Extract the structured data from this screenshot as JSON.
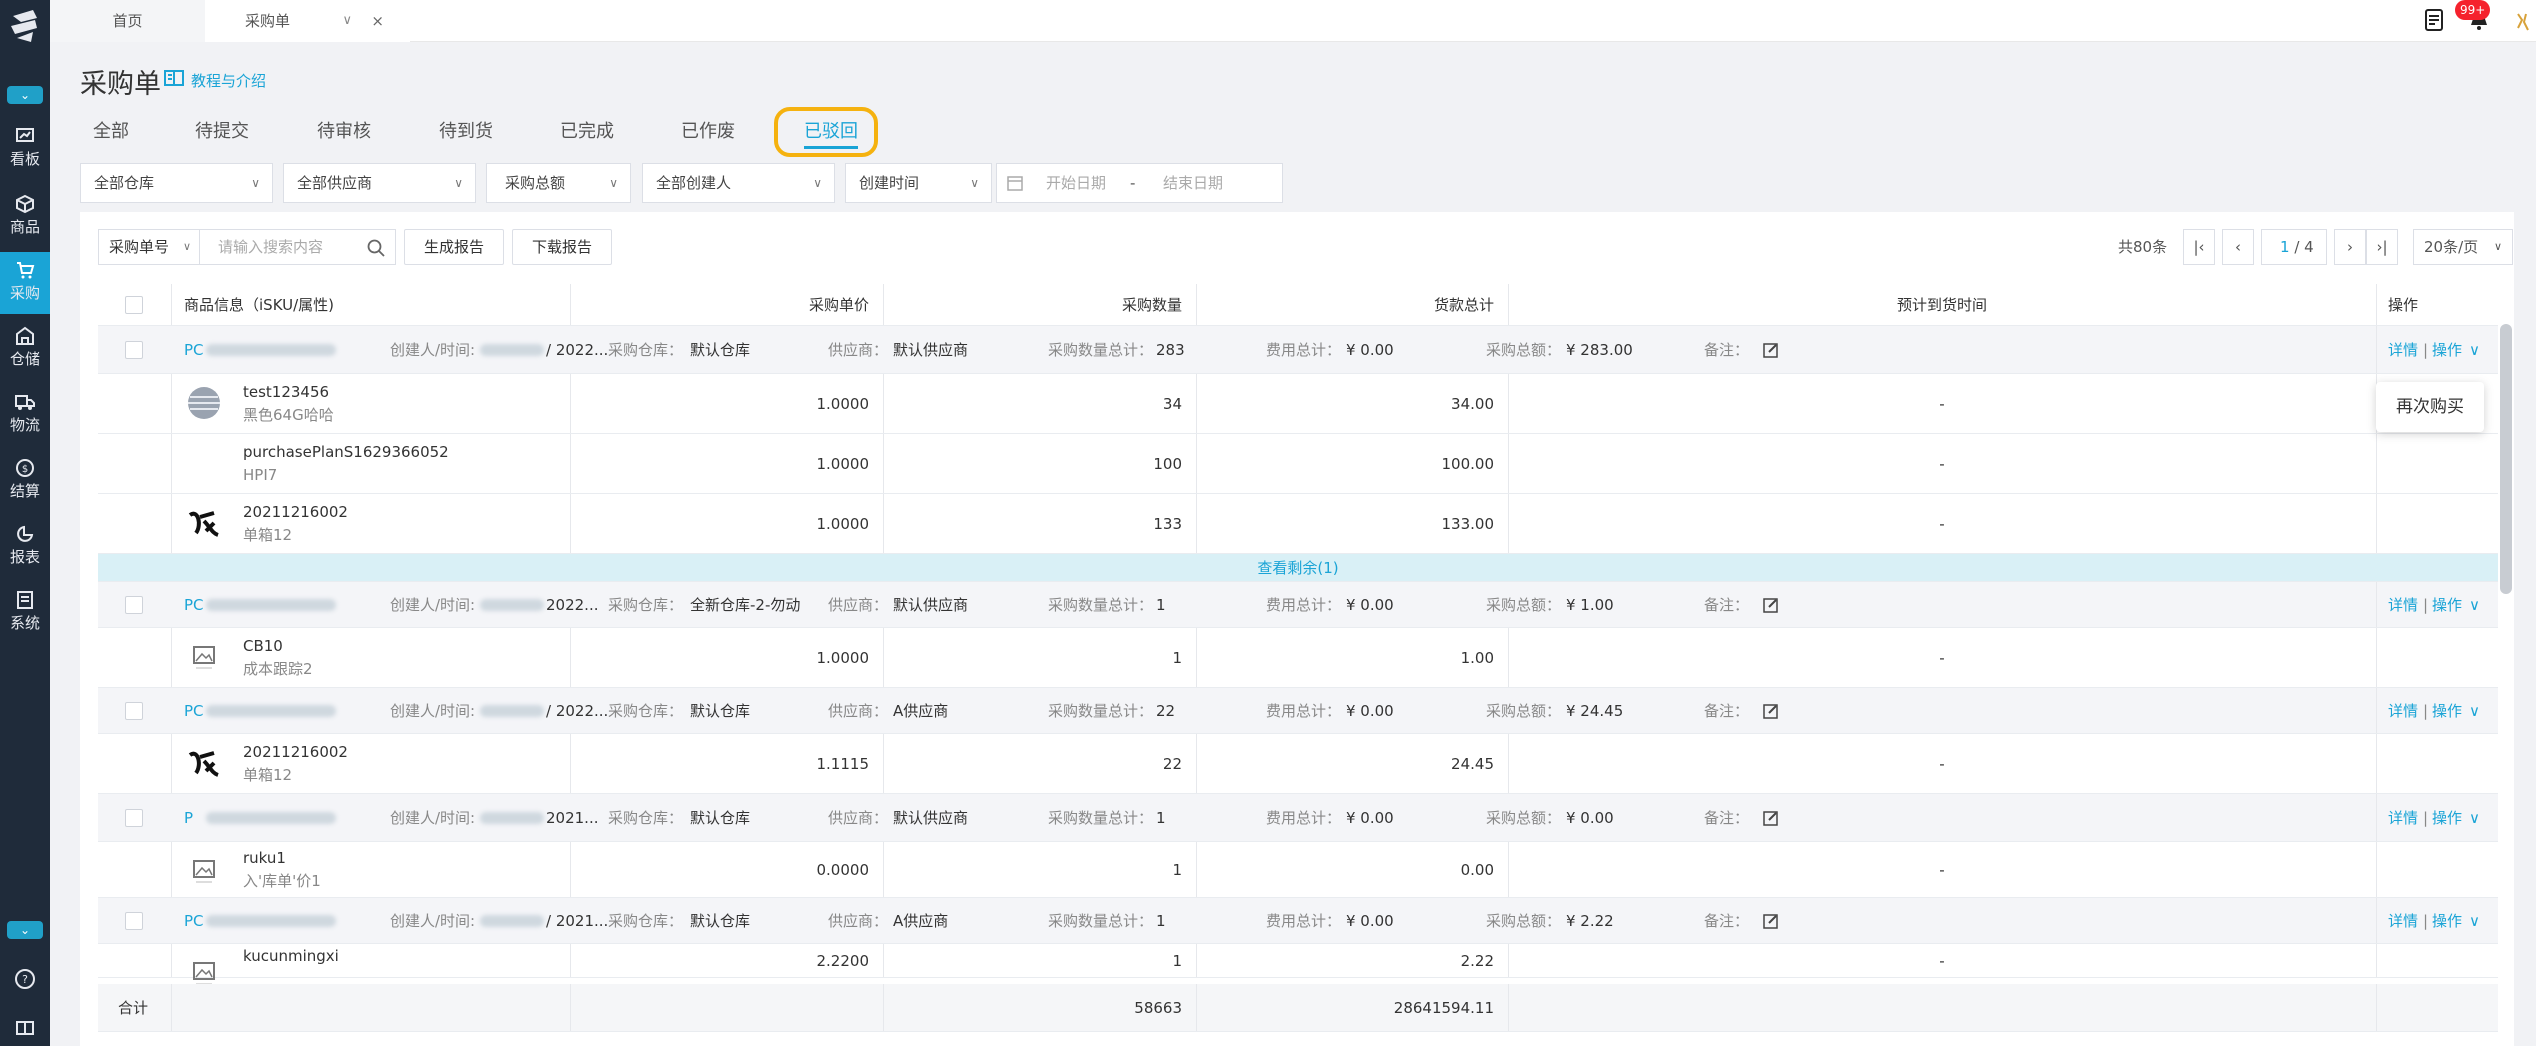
{
  "sidebar": {
    "items": [
      {
        "name": "dashboard",
        "label": "看板"
      },
      {
        "name": "goods",
        "label": "商品"
      },
      {
        "name": "purchase",
        "label": "采购"
      },
      {
        "name": "warehouse",
        "label": "仓储"
      },
      {
        "name": "logistics",
        "label": "物流"
      },
      {
        "name": "settlement",
        "label": "结算"
      },
      {
        "name": "report",
        "label": "报表"
      },
      {
        "name": "system",
        "label": "系统"
      }
    ]
  },
  "topbar": {
    "tab_home": "首页",
    "tab_purchase": "采购单",
    "close": "×",
    "badge": "99+"
  },
  "page": {
    "title": "采购单",
    "tutorial_link": "教程与介绍"
  },
  "status_tabs": [
    "全部",
    "待提交",
    "待审核",
    "待到货",
    "已完成",
    "已作废",
    "已驳回"
  ],
  "filters": {
    "warehouse": "全部仓库",
    "supplier": "全部供应商",
    "total": "采购总额",
    "creator": "全部创建人",
    "time": "创建时间",
    "start_date": "开始日期",
    "date_sep": "-",
    "end_date": "结束日期"
  },
  "search": {
    "field": "采购单号",
    "placeholder": "请输入搜索内容",
    "gen_report": "生成报告",
    "download_report": "下载报告"
  },
  "pagination": {
    "total": "共80条",
    "current": "1",
    "of": "/ 4",
    "page_size": "20条/页"
  },
  "columns": {
    "info": "商品信息（iSKU/属性)",
    "unit_price": "采购单价",
    "qty": "采购数量",
    "amount": "货款总计",
    "eta": "预计到货时间",
    "ops": "操作"
  },
  "labels": {
    "creator": "创建人/时间:",
    "warehouse": "采购仓库：",
    "supplier": "供应商：",
    "qty_total": "采购数量总计：",
    "fee_total": "费用总计：",
    "purchase_total": "采购总额：",
    "remark": "备注：",
    "detail": "详情",
    "ops": "操作",
    "sep": "|"
  },
  "orders": [
    {
      "id_prefix": "PC",
      "date": "/ 2022...",
      "warehouse": "默认仓库",
      "supplier": "默认供应商",
      "qty_total": "283",
      "fee_total": "¥ 0.00",
      "purchase_total": "¥ 283.00",
      "items": [
        {
          "name": "test123456",
          "sku": "黑色64G哈哈",
          "price": "1.0000",
          "qty": "34",
          "amount": "34.00",
          "eta": "-",
          "img": "circle"
        },
        {
          "name": "purchasePlanS1629366052",
          "sku": "HPI7",
          "price": "1.0000",
          "qty": "100",
          "amount": "100.00",
          "eta": "-",
          "img": "none"
        },
        {
          "name": "20211216002",
          "sku": "单箱12",
          "price": "1.0000",
          "qty": "133",
          "amount": "133.00",
          "eta": "-",
          "img": "calli"
        }
      ]
    },
    {
      "id_prefix": "PC",
      "date": "2022...",
      "warehouse": "全新仓库-2-勿动",
      "supplier": "默认供应商",
      "qty_total": "1",
      "fee_total": "¥ 0.00",
      "purchase_total": "¥ 1.00",
      "items": [
        {
          "name": "CB10",
          "sku": "成本跟踪2",
          "price": "1.0000",
          "qty": "1",
          "amount": "1.00",
          "eta": "-",
          "img": "placeholder"
        }
      ]
    },
    {
      "id_prefix": "PC",
      "date": "/ 2022...",
      "warehouse": "默认仓库",
      "supplier": "A供应商",
      "qty_total": "22",
      "fee_total": "¥ 0.00",
      "purchase_total": "¥ 24.45",
      "items": [
        {
          "name": "20211216002",
          "sku": "单箱12",
          "price": "1.1115",
          "qty": "22",
          "amount": "24.45",
          "eta": "-",
          "img": "calli"
        }
      ]
    },
    {
      "id_prefix": "P",
      "date": "2021...",
      "warehouse": "默认仓库",
      "supplier": "默认供应商",
      "qty_total": "1",
      "fee_total": "¥ 0.00",
      "purchase_total": "¥ 0.00",
      "items": [
        {
          "name": "ruku1",
          "sku": "入'库单'价1",
          "price": "0.0000",
          "qty": "1",
          "amount": "0.00",
          "eta": "-",
          "img": "placeholder"
        }
      ]
    },
    {
      "id_prefix": "PC",
      "date": "/ 2021...",
      "warehouse": "默认仓库",
      "supplier": "A供应商",
      "qty_total": "1",
      "fee_total": "¥ 0.00",
      "purchase_total": "¥ 2.22",
      "items": [
        {
          "name": "kucunmingxi",
          "sku": "",
          "price": "2.2200",
          "qty": "1",
          "amount": "2.22",
          "eta": "-",
          "img": "placeholder"
        }
      ]
    }
  ],
  "view_more": "查看剩余(1)",
  "totals": {
    "label": "合计",
    "qty": "58663",
    "amount": "28641594.11"
  },
  "popup": {
    "rebuy": "再次购买"
  },
  "colors": {
    "accent": "#1aa4d6",
    "sidebar": "#1f2b3a",
    "highlight": "#f5b20f"
  }
}
